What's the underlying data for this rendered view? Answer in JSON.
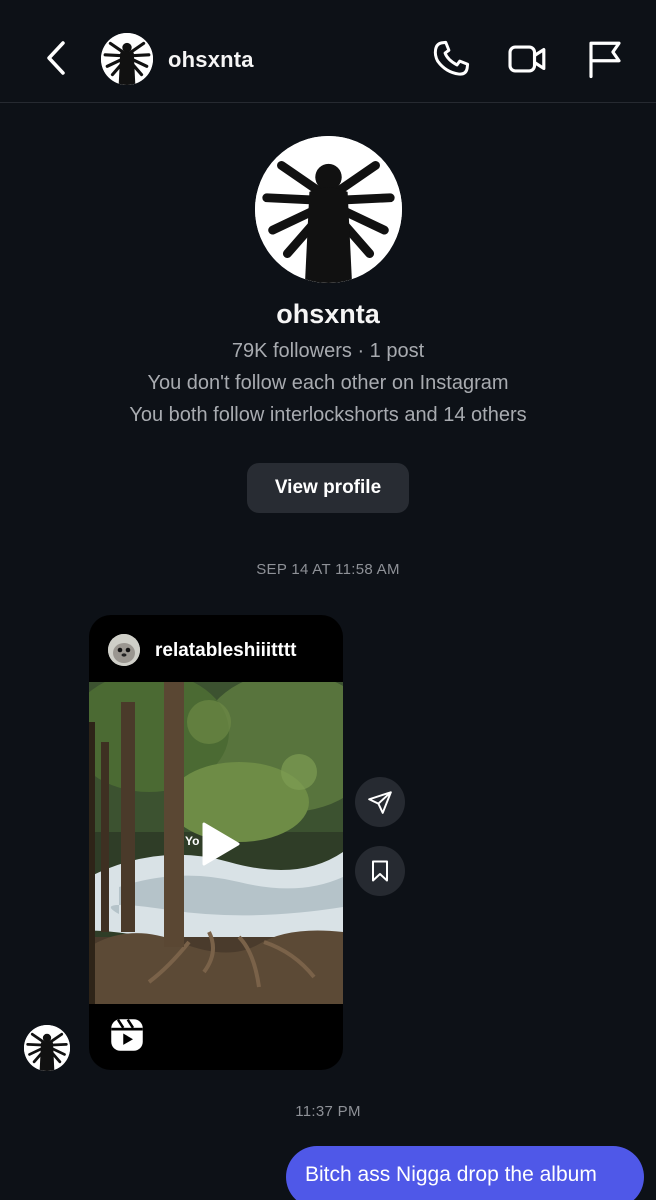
{
  "header": {
    "username": "ohsxnta",
    "icons": [
      "back-icon",
      "phone-icon",
      "video-camera-icon",
      "flag-icon"
    ]
  },
  "profile": {
    "name": "ohsxnta",
    "stats": "79K followers · 1 post",
    "follow_status": "You don't follow each other on Instagram",
    "mutuals": "You both follow interlockshorts and 14 others",
    "view_profile_label": "View profile"
  },
  "messages": {
    "first_timestamp": "SEP 14 AT 11:58 AM",
    "shared_post": {
      "username": "relatableshiiitttt",
      "media_overlay_text": "Yo"
    },
    "second_timestamp": "11:37 PM",
    "sent_text": "Bitch ass Nigga drop the album"
  },
  "colors": {
    "background": "#0d1117",
    "sent_bubble": "#4f58e8",
    "button_bg": "#282c33",
    "muted_text": "#a8abb0"
  }
}
